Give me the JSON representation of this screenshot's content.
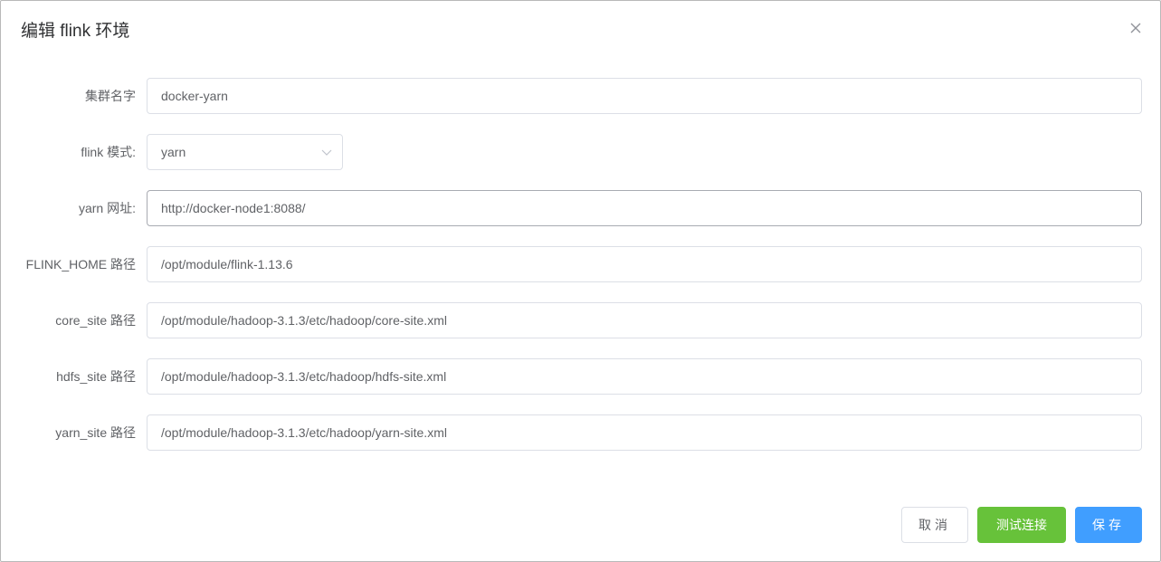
{
  "dialog": {
    "title": "编辑 flink 环境"
  },
  "form": {
    "cluster_name": {
      "label": "集群名字",
      "value": "docker-yarn"
    },
    "flink_mode": {
      "label": "flink 模式:",
      "value": "yarn"
    },
    "yarn_url": {
      "label": "yarn 网址:",
      "value": "http://docker-node1:8088/"
    },
    "flink_home": {
      "label": "FLINK_HOME 路径",
      "value": "/opt/module/flink-1.13.6"
    },
    "core_site": {
      "label": "core_site 路径",
      "value": "/opt/module/hadoop-3.1.3/etc/hadoop/core-site.xml"
    },
    "hdfs_site": {
      "label": "hdfs_site 路径",
      "value": "/opt/module/hadoop-3.1.3/etc/hadoop/hdfs-site.xml"
    },
    "yarn_site": {
      "label": "yarn_site 路径",
      "value": "/opt/module/hadoop-3.1.3/etc/hadoop/yarn-site.xml"
    }
  },
  "footer": {
    "cancel_label": "取消",
    "test_label": "测试连接",
    "save_label": "保存"
  },
  "icons": {
    "close": "close-icon",
    "select_arrow": "chevron-down-icon"
  },
  "colors": {
    "test_button": "#67c23a",
    "save_button": "#409eff",
    "border": "#dcdfe6",
    "text": "#606266"
  }
}
